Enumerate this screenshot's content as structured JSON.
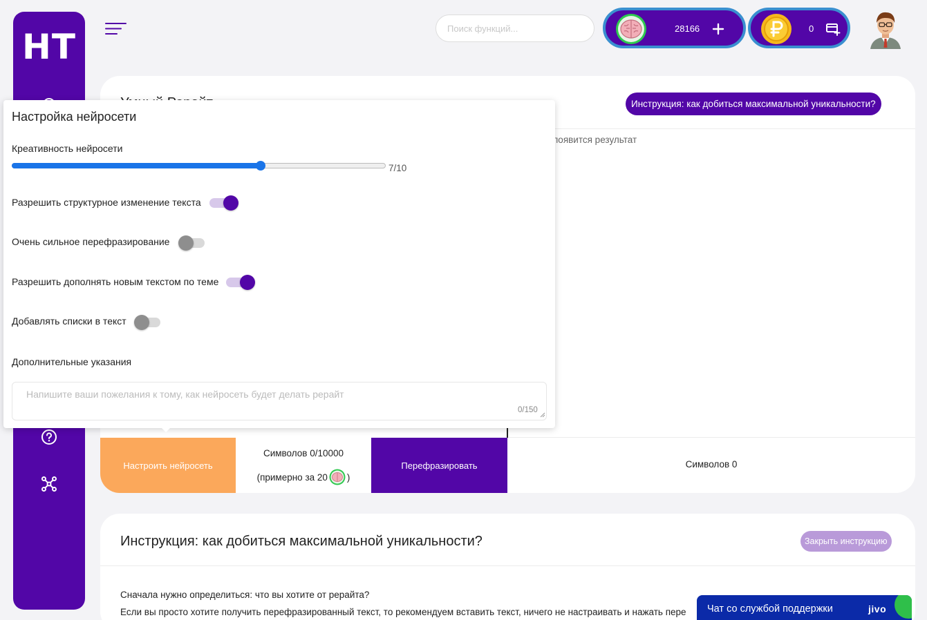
{
  "app": {
    "logo": "НТ"
  },
  "header": {
    "search_placeholder": "Поиск функций...",
    "brain_balance": "28166",
    "rub_balance": "0"
  },
  "main": {
    "title": "Умный Рерайт",
    "instruction_button": "Инструкция: как добиться максимальной уникальности?",
    "result_hint": "появится результат",
    "setup_button": "Настроить нейросеть",
    "symbols_left": "Символов 0/10000",
    "approx_prefix": "(примерно за 20",
    "approx_suffix": ")",
    "rephrase_button": "Перефразировать",
    "symbols_right": "Символов 0"
  },
  "popup": {
    "title": "Настройка нейросети",
    "creativity_label": "Креативность нейросети",
    "creativity_value": 7,
    "creativity_max": 10,
    "creativity_text": "7/10",
    "options": [
      {
        "label": "Разрешить структурное изменение текста",
        "on": true
      },
      {
        "label": "Очень сильное перефразирование",
        "on": false
      },
      {
        "label": "Разрешить дополнять новым текстом по теме",
        "on": true
      },
      {
        "label": "Добавлять списки в текст",
        "on": false
      }
    ],
    "extra_label": "Дополнительные указания",
    "extra_placeholder": "Напишите ваши пожелания к тому, как нейросеть будет делать рерайт",
    "extra_count": "0/150"
  },
  "instructions": {
    "title": "Инструкция: как добиться максимальной уникальности?",
    "close_button": "Закрыть инструкцию",
    "para1": "Сначала нужно определиться: что вы хотите от рерайта?",
    "para2": "Если вы просто хотите получить перефразированный текст, то рекомендуем вставить текст, ничего не настраивать и нажать пере"
  },
  "chat": {
    "label": "Чат со службой поддержки",
    "brand": "jivo"
  },
  "colors": {
    "primary": "#5206a7",
    "accent": "#fba85b",
    "slider": "#1a74e8",
    "chat": "#0b2aa8"
  }
}
